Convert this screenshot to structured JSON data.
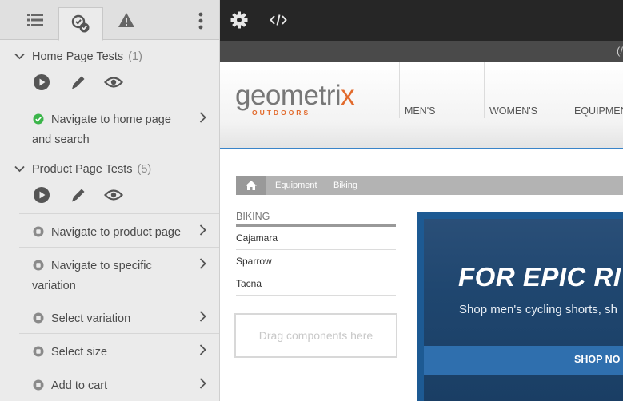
{
  "panel": {
    "tabs": [
      {
        "icon": "list-icon"
      },
      {
        "icon": "test-runner-icon",
        "active": true
      },
      {
        "icon": "warning-icon"
      }
    ],
    "more_icon": "more-vertical-icon",
    "suites": [
      {
        "title": "Home Page Tests",
        "count": "(1)",
        "cases": [
          {
            "label": "Navigate to home page and search",
            "status": "passed"
          }
        ]
      },
      {
        "title": "Product Page Tests",
        "count": "(5)",
        "cases": [
          {
            "label": "Navigate to product page",
            "status": "not-run"
          },
          {
            "label": "Navigate to specific variation",
            "status": "not-run"
          },
          {
            "label": "Select variation",
            "status": "not-run"
          },
          {
            "label": "Select size",
            "status": "not-run"
          },
          {
            "label": "Add to cart",
            "status": "not-run"
          }
        ]
      }
    ],
    "action_icons": [
      "play-icon",
      "edit-icon",
      "preview-icon"
    ]
  },
  "toolbar": {
    "icons": [
      "gear-icon",
      "code-icon"
    ],
    "strip_text": "(/"
  },
  "site": {
    "logo_word_a": "geometri",
    "logo_word_x": "x",
    "logo_sub": "OUTDOORS",
    "nav": [
      "MEN'S",
      "WOMEN'S",
      "EQUIPMEN"
    ],
    "breadcrumb": [
      "Equipment",
      "Biking"
    ],
    "subnav_title": "BIKING",
    "subnav_items": [
      "Cajamara",
      "Sparrow",
      "Tacna"
    ],
    "dropzone": "Drag components here",
    "banner_head": "FOR EPIC RI",
    "banner_sub": "Shop men's cycling shorts, sh",
    "banner_cta": "SHOP NO"
  },
  "colors": {
    "passed": "#3bb54a",
    "not_run": "#8a8a8a",
    "accent_blue": "#3a84c9",
    "brand_orange": "#e26a2c"
  }
}
